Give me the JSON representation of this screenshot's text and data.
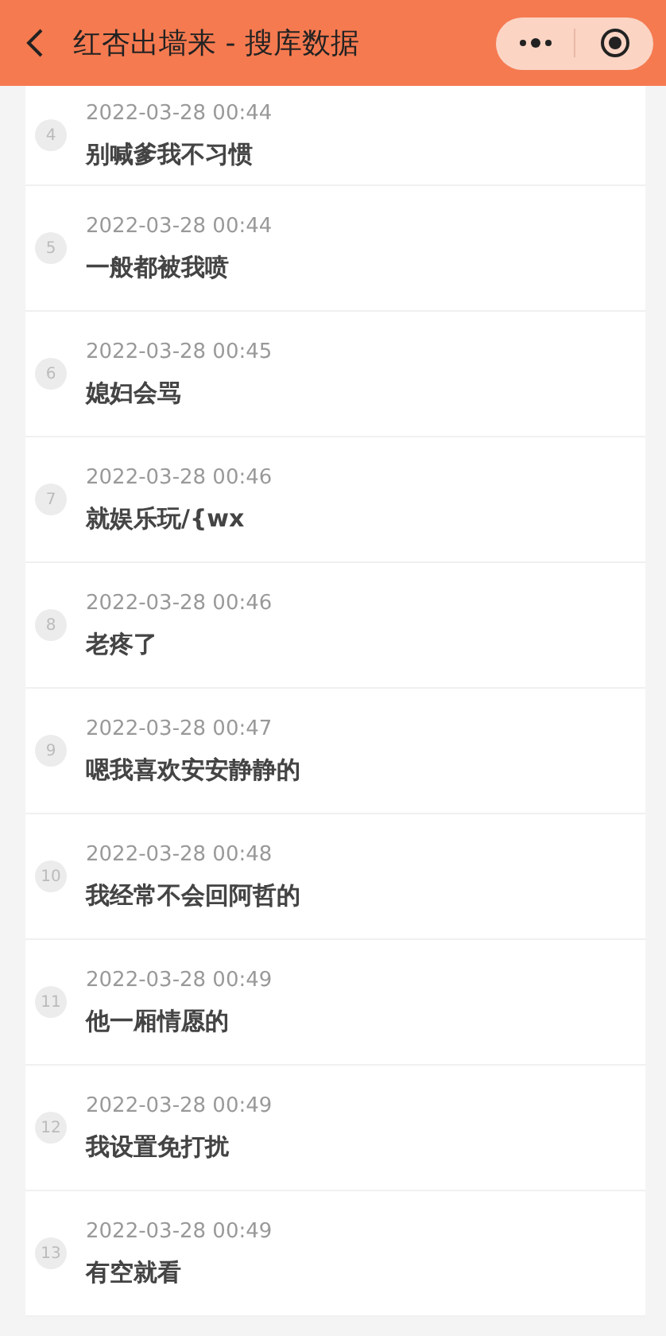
{
  "header": {
    "title": "红杏出墙来 - 搜库数据"
  },
  "records": [
    {
      "index": "4",
      "time": "2022-03-28 00:44",
      "text": "别喊爹我不习惯"
    },
    {
      "index": "5",
      "time": "2022-03-28 00:44",
      "text": "一般都被我喷"
    },
    {
      "index": "6",
      "time": "2022-03-28 00:45",
      "text": "媳妇会骂"
    },
    {
      "index": "7",
      "time": "2022-03-28 00:46",
      "text": "就娱乐玩/{wx"
    },
    {
      "index": "8",
      "time": "2022-03-28 00:46",
      "text": "老疼了"
    },
    {
      "index": "9",
      "time": "2022-03-28 00:47",
      "text": "嗯我喜欢安安静静的"
    },
    {
      "index": "10",
      "time": "2022-03-28 00:48",
      "text": "我经常不会回阿哲的"
    },
    {
      "index": "11",
      "time": "2022-03-28 00:49",
      "text": "他一厢情愿的"
    },
    {
      "index": "12",
      "time": "2022-03-28 00:49",
      "text": "我设置免打扰"
    },
    {
      "index": "13",
      "time": "2022-03-28 00:49",
      "text": "有空就看"
    }
  ]
}
